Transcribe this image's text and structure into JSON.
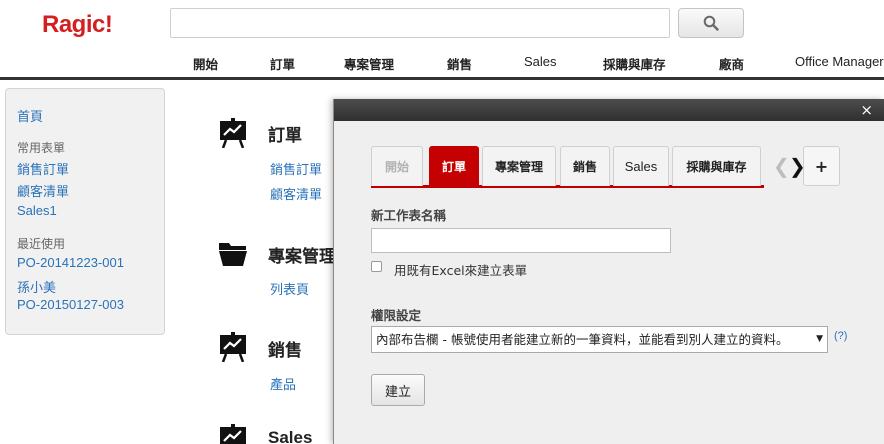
{
  "header": {
    "logo": "Ragic!",
    "search": {
      "value": "",
      "placeholder": ""
    },
    "nav": [
      "開始",
      "訂單",
      "專案管理",
      "銷售",
      "Sales",
      "採購與庫存",
      "廠商",
      "Office Manager"
    ]
  },
  "sidebar": {
    "home": "首頁",
    "frequent_heading": "常用表單",
    "frequent": [
      "銷售訂單",
      "顧客清單",
      "Sales1"
    ],
    "recent_heading": "最近使用",
    "recent": [
      "PO-20141223-001",
      "孫小美",
      "PO-20150127-003"
    ]
  },
  "main": {
    "sections": [
      {
        "title": "訂單",
        "links": [
          "銷售訂單",
          "顧客清單"
        ]
      },
      {
        "title": "專案管理",
        "links": [
          "列表頁"
        ]
      },
      {
        "title": "銷售",
        "links": [
          "產品"
        ]
      },
      {
        "title": "Sales",
        "links": []
      }
    ]
  },
  "dialog": {
    "close": "×",
    "tabs": [
      "開始",
      "訂單",
      "專案管理",
      "銷售",
      "Sales",
      "採購與庫存"
    ],
    "active_tab": "訂單",
    "add_tab": "+",
    "name_label": "新工作表名稱",
    "name_value": "",
    "excel_checkbox_label": "用既有Excel來建立表單",
    "excel_checked": false,
    "permission_label": "權限設定",
    "permission_value": "內部布告欄 - 帳號使用者能建立新的一筆資料，並能看到別人建立的資料。",
    "help": "(?)",
    "create_button": "建立"
  },
  "colors": {
    "brand": "#d31f1f",
    "active_tab": "#c40000",
    "link": "#2a73b8"
  }
}
